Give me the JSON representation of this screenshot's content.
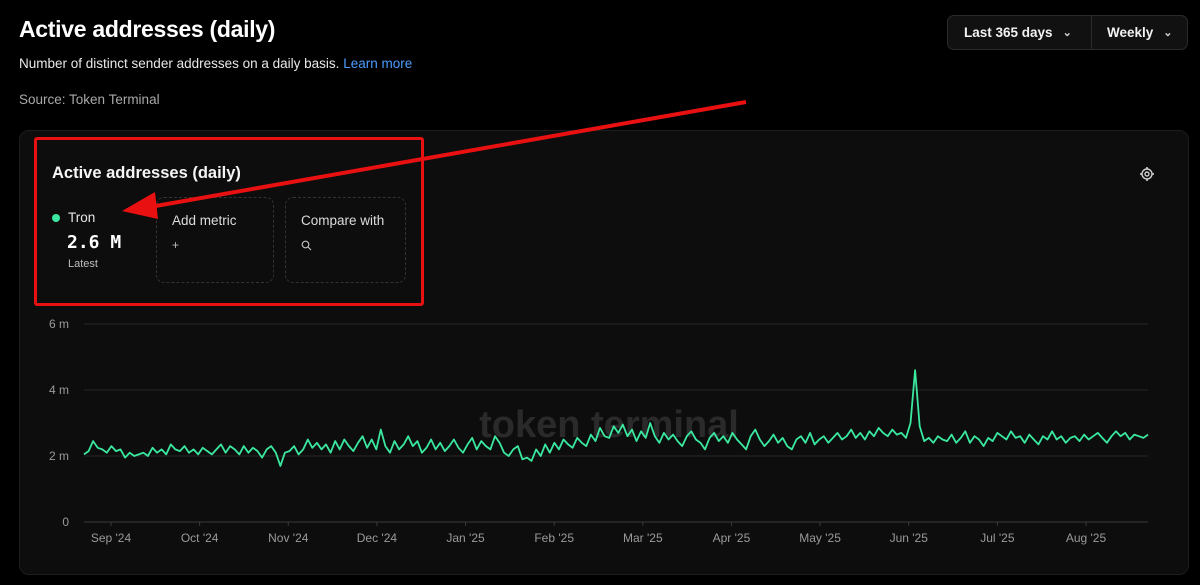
{
  "header": {
    "title": "Active addresses (daily)",
    "subtitle": "Number of distinct sender addresses on a daily basis.",
    "learn_more": "Learn more",
    "source": "Source: Token Terminal"
  },
  "controls": {
    "range_label": "Last 365 days",
    "interval_label": "Weekly"
  },
  "panel": {
    "title": "Active addresses (daily)",
    "metric": {
      "name": "Tron",
      "value": "2.6 M",
      "caption": "Latest",
      "color": "#3ae8a0"
    },
    "add_metric_label": "Add metric",
    "compare_label": "Compare with",
    "watermark": "token terminal"
  },
  "colors": {
    "annotation": "#e81010",
    "line": "#3ae8a0",
    "link": "#4c9cff"
  },
  "chart_data": {
    "type": "line",
    "series": [
      {
        "name": "Tron",
        "values": [
          2.05,
          2.15,
          2.45,
          2.25,
          2.2,
          2.1,
          2.3,
          2.15,
          2.2,
          1.95,
          2.1,
          2.0,
          2.05,
          2.1,
          2.0,
          2.25,
          2.1,
          2.2,
          2.05,
          2.35,
          2.2,
          2.15,
          2.3,
          2.1,
          2.2,
          2.05,
          2.25,
          2.15,
          2.05,
          2.2,
          2.35,
          2.1,
          2.3,
          2.2,
          2.05,
          2.3,
          2.1,
          2.25,
          2.15,
          1.95,
          2.2,
          2.3,
          2.1,
          1.7,
          2.1,
          2.15,
          2.3,
          2.05,
          2.2,
          2.5,
          2.25,
          2.4,
          2.2,
          2.35,
          2.1,
          2.45,
          2.2,
          2.5,
          2.3,
          2.15,
          2.4,
          2.6,
          2.25,
          2.5,
          2.2,
          2.8,
          2.3,
          2.1,
          2.45,
          2.2,
          2.35,
          2.6,
          2.3,
          2.45,
          2.1,
          2.25,
          2.5,
          2.2,
          2.4,
          2.15,
          2.3,
          2.5,
          2.25,
          2.1,
          2.35,
          2.55,
          2.2,
          2.45,
          2.3,
          2.2,
          2.6,
          2.4,
          2.1,
          2.0,
          2.2,
          2.3,
          1.9,
          1.95,
          1.85,
          2.2,
          2.0,
          2.35,
          2.1,
          2.4,
          2.2,
          2.5,
          2.35,
          2.25,
          2.55,
          2.4,
          2.3,
          2.65,
          2.45,
          2.85,
          2.6,
          2.55,
          2.9,
          2.7,
          2.95,
          2.6,
          2.8,
          2.45,
          2.75,
          2.55,
          3.0,
          2.6,
          2.4,
          2.7,
          2.5,
          2.65,
          2.45,
          2.3,
          2.6,
          2.75,
          2.5,
          2.4,
          2.2,
          2.55,
          2.7,
          2.45,
          2.6,
          2.4,
          2.7,
          2.5,
          2.35,
          2.2,
          2.6,
          2.8,
          2.5,
          2.3,
          2.45,
          2.65,
          2.4,
          2.55,
          2.3,
          2.2,
          2.5,
          2.6,
          2.4,
          2.7,
          2.35,
          2.5,
          2.6,
          2.4,
          2.55,
          2.7,
          2.5,
          2.6,
          2.8,
          2.55,
          2.7,
          2.5,
          2.75,
          2.6,
          2.85,
          2.7,
          2.6,
          2.8,
          2.65,
          2.7,
          2.55,
          3.0,
          4.6,
          2.9,
          2.45,
          2.55,
          2.4,
          2.6,
          2.5,
          2.45,
          2.65,
          2.4,
          2.55,
          2.75,
          2.4,
          2.6,
          2.5,
          2.3,
          2.55,
          2.45,
          2.7,
          2.6,
          2.5,
          2.75,
          2.55,
          2.6,
          2.4,
          2.65,
          2.5,
          2.35,
          2.6,
          2.5,
          2.75,
          2.5,
          2.6,
          2.4,
          2.55,
          2.6,
          2.45,
          2.65,
          2.5,
          2.6,
          2.7,
          2.55,
          2.4,
          2.6,
          2.75,
          2.6,
          2.7,
          2.5,
          2.65,
          2.6,
          2.55,
          2.65
        ]
      }
    ],
    "x_ticks": [
      "Sep '24",
      "Oct '24",
      "Nov '24",
      "Dec '24",
      "Jan '25",
      "Feb '25",
      "Mar '25",
      "Apr '25",
      "May '25",
      "Jun '25",
      "Jul '25",
      "Aug '25"
    ],
    "y_ticks": [
      "0",
      "2 m",
      "4 m",
      "6 m"
    ],
    "ylim": [
      0,
      6
    ],
    "ylabel": "",
    "xlabel": "",
    "grid": true
  }
}
